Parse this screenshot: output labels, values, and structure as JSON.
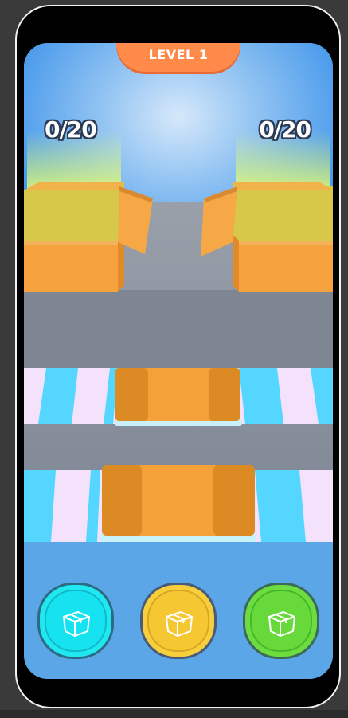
{
  "hud": {
    "level_label": "LEVEL 1",
    "left_counter": "0/20",
    "right_counter": "0/20"
  },
  "buttons": [
    {
      "name": "cyan-box-button",
      "icon": "box-icon",
      "color": "#1fe8f0"
    },
    {
      "name": "yellow-box-button",
      "icon": "box-icon",
      "color": "#f7cf3a"
    },
    {
      "name": "green-box-button",
      "icon": "box-icon",
      "color": "#6ddc3f"
    }
  ],
  "colors": {
    "sky_top": "#1a86f0",
    "sky_glow": "#cfe3f8",
    "floor": "#7d8594",
    "bin": "#f6a23e",
    "belt_pink": "#f4e1fb",
    "belt_cyan": "#55d6ff",
    "bottom_panel": "#5aa6e6"
  }
}
